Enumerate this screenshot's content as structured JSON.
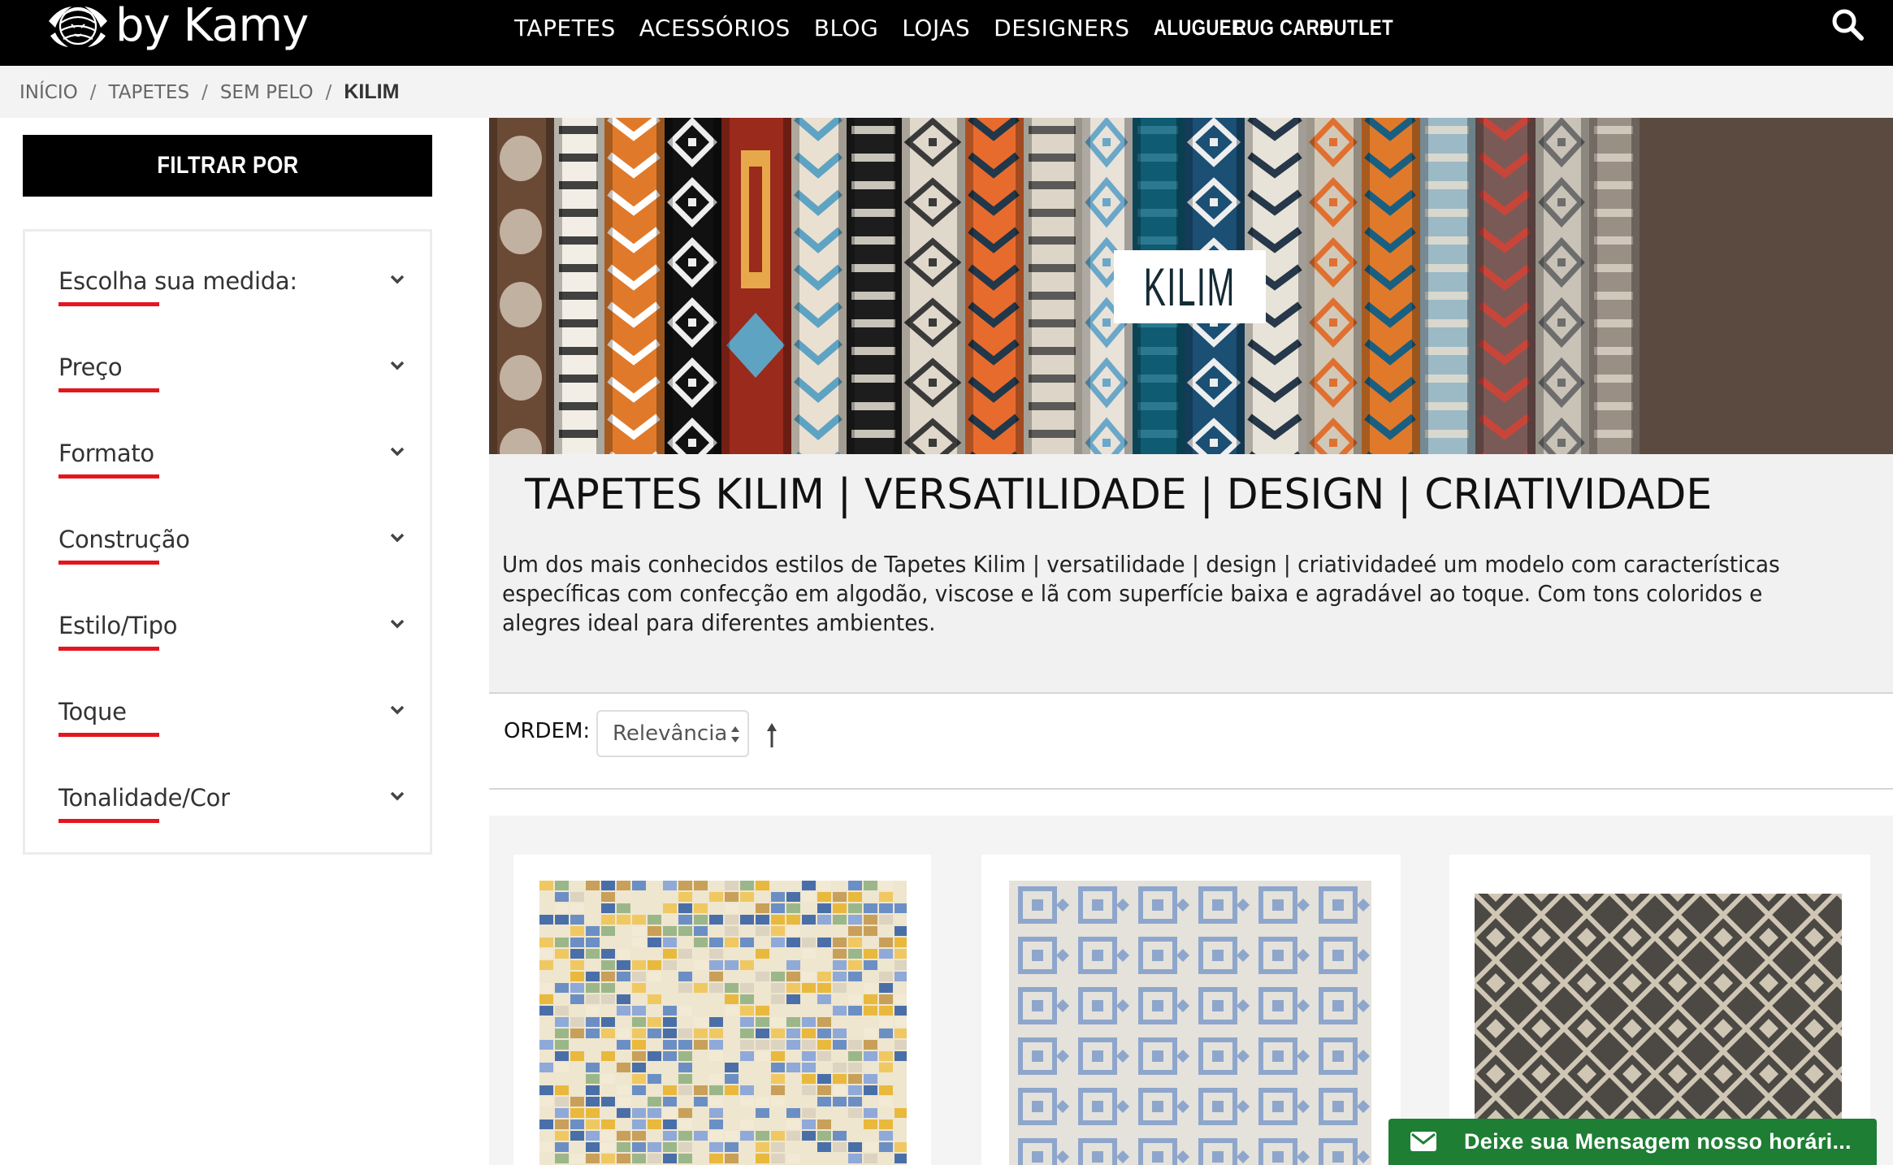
{
  "brand": {
    "logo_text": "by Kamy"
  },
  "nav": {
    "items": [
      "TAPETES",
      "ACESSÓRIOS",
      "BLOG",
      "LOJAS",
      "DESIGNERS"
    ],
    "bold_items": [
      "ALUGUEL",
      "RUG CARE",
      "OUTLET"
    ],
    "search_icon": "search-icon"
  },
  "breadcrumb": {
    "items": [
      "INÍCIO",
      "TAPETES",
      "SEM PELO"
    ],
    "current": "KILIM",
    "separator": "/"
  },
  "sidebar": {
    "header": "FILTRAR POR",
    "filters": [
      {
        "label": "Escolha sua medida:"
      },
      {
        "label": "Preço"
      },
      {
        "label": "Formato"
      },
      {
        "label": "Construção"
      },
      {
        "label": "Estilo/Tipo"
      },
      {
        "label": "Toque"
      },
      {
        "label": "Tonalidade/Cor"
      }
    ],
    "accent_color": "#e3161f"
  },
  "hero": {
    "tag": "KILIM"
  },
  "intro": {
    "title": "TAPETES KILIM | VERSATILIDADE | DESIGN | CRIATIVIDADE",
    "description": "Um dos mais conhecidos estilos de Tapetes Kilim | versatilidade | design | criatividadeé um modelo com características específicas com confecção em algodão, viscose e lã com superfície baixa e agradável ao toque. Com tons coloridos e alegres ideal para diferentes ambientes."
  },
  "sort": {
    "label": "ORDEM:",
    "selected": "Relevância",
    "direction_icon": "arrow-up-icon"
  },
  "products": [
    {
      "name": "product-kilim-multicolor"
    },
    {
      "name": "product-kilim-blue-geometric"
    },
    {
      "name": "product-kilim-grey-diamond"
    }
  ],
  "chat": {
    "label": "Deixe sua Mensagem nosso horári...",
    "color": "#1e7e34"
  }
}
